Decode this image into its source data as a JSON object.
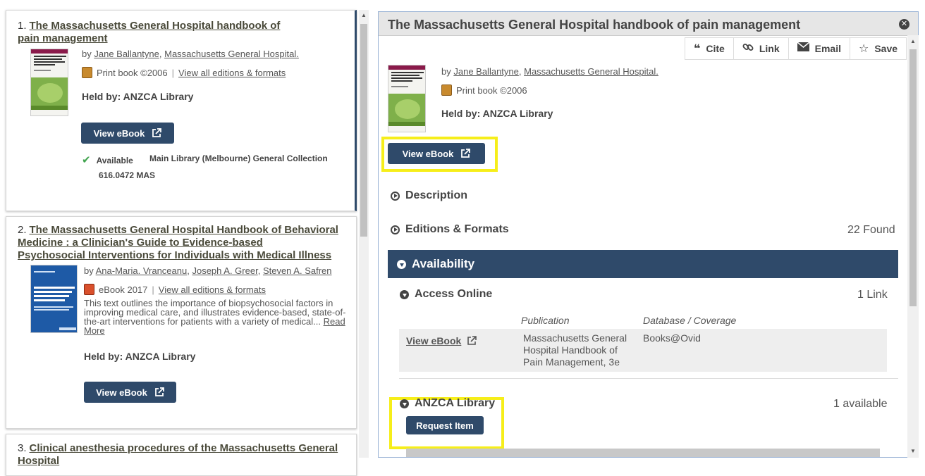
{
  "results": [
    {
      "number": "1.",
      "title": "The Massachusetts General Hospital handbook of pain management",
      "by": "by",
      "authors": [
        "Jane Ballantyne",
        "Massachusetts General Hospital."
      ],
      "format": "Print book ©2006",
      "all_editions": "View all editions & formats",
      "held_by": "Held by: ANZCA Library",
      "view_ebook": "View eBook",
      "availability": "Available",
      "location": "Main Library (Melbourne) General Collection",
      "call_number": "616.0472 MAS"
    },
    {
      "number": "2.",
      "title_lines": [
        "The Massachusetts General Hospital Handbook of Behavioral",
        "Medicine : a Clinician's Guide to Evidence-based",
        "Psychosocial Interventions for Individuals with Medical Illness"
      ],
      "by": "by",
      "authors": [
        "Ana-Maria. Vranceanu",
        "Joseph A. Greer",
        "Steven A. Safren"
      ],
      "format": "eBook 2017",
      "all_editions": "View all editions & formats",
      "description_lines": [
        "This text outlines the importance of biopsychosocial factors in",
        "improving medical care, and illustrates evidence-based, state-of-",
        "the-art interventions for patients with a variety of medical..."
      ],
      "read": "Read",
      "more": "More",
      "held_by": "Held by: ANZCA Library",
      "view_ebook": "View eBook"
    },
    {
      "number": "3.",
      "title_lines": [
        "Clinical anesthesia procedures of the Massachusetts General",
        "Hospital"
      ]
    }
  ],
  "detail": {
    "title": "The Massachusetts General Hospital handbook of pain management",
    "tools": [
      {
        "label": "Cite",
        "icon": "quote-icon"
      },
      {
        "label": "Link",
        "icon": "link-icon"
      },
      {
        "label": "Email",
        "icon": "envelope-icon"
      },
      {
        "label": "Save",
        "icon": "star-icon"
      }
    ],
    "by": "by",
    "authors": [
      "Jane Ballantyne",
      "Massachusetts General Hospital."
    ],
    "format": "Print book ©2006",
    "held_by": "Held by: ANZCA Library",
    "view_ebook": "View eBook",
    "description_label": "Description",
    "editions_label": "Editions & Formats",
    "editions_count": "22 Found",
    "availability_label": "Availability",
    "access_online_label": "Access Online",
    "access_online_count": "1 Link",
    "col_publication": "Publication",
    "col_database": "Database / Coverage",
    "row_view_ebook": "View eBook",
    "row_publication_lines": [
      "Massachusetts General",
      "Hospital Handbook of",
      "Pain Management, 3e"
    ],
    "row_database": "Books@Ovid",
    "library_label": "ANZCA Library",
    "library_count": "1 available",
    "request_item": "Request Item"
  },
  "colors": {
    "accent": "#2f4a6a",
    "highlight": "#f6ee1a",
    "available_check": "#3fa34d"
  }
}
